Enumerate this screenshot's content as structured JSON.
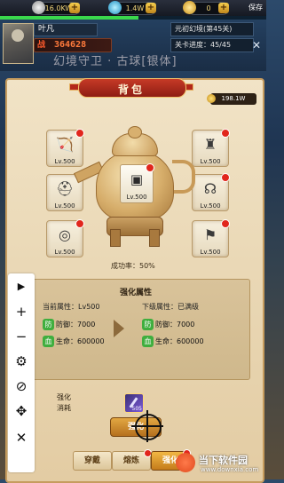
{
  "resources": [
    {
      "value": "16.0KW",
      "icon": "silver-coin-icon",
      "color": "#c9c9c9"
    },
    {
      "value": "1.4W",
      "icon": "diamond-icon",
      "color": "#36c4e8"
    },
    {
      "value": "0",
      "icon": "gold-ingot-icon",
      "color": "#f2c13a"
    }
  ],
  "save_label": "保存",
  "player": {
    "name": "叶凡",
    "power_label": "战",
    "power": "364628",
    "exp_fraction": 0.52
  },
  "stage": {
    "name": "元初幻境(第45关)",
    "progress": "关卡进度：45/45"
  },
  "scene_text": "幻境守卫 · 古球[银体]",
  "bag": {
    "title": "背包",
    "gold": "198.1W",
    "slots_left": [
      {
        "name": "weapon",
        "icon": "bow-icon",
        "glyph": "🏹",
        "level": "Lv.500"
      },
      {
        "name": "helmet",
        "icon": "helmet-icon",
        "glyph": "⛑",
        "level": "Lv.500"
      },
      {
        "name": "bracer",
        "icon": "bracer-icon",
        "glyph": "◎",
        "level": "Lv.500"
      }
    ],
    "slots_right": [
      {
        "name": "armor",
        "icon": "armor-icon",
        "glyph": "♜",
        "level": "Lv.500"
      },
      {
        "name": "necklace",
        "icon": "necklace-icon",
        "glyph": "☊",
        "level": "Lv.500"
      },
      {
        "name": "boots",
        "icon": "boots-icon",
        "glyph": "⚑",
        "level": "Lv.500"
      }
    ],
    "center_slot": {
      "icon": "belt-icon",
      "glyph": "▣",
      "level": "Lv.500"
    },
    "success_rate": "成功率：50%"
  },
  "enhance": {
    "title": "强化属性",
    "current": {
      "header": "当前属性：Lv500",
      "rows": [
        {
          "tag": "防",
          "label": "防御：",
          "value": "7000"
        },
        {
          "tag": "血",
          "label": "生命：",
          "value": "600000"
        }
      ]
    },
    "next": {
      "header": "下级属性：已满级",
      "rows": [
        {
          "tag": "防",
          "label": "防御：",
          "value": "7000"
        },
        {
          "tag": "血",
          "label": "生命：",
          "value": "600000"
        }
      ]
    },
    "cost_label_1": "强化",
    "cost_label_2": "消耗",
    "material_count": "505",
    "button": "强化"
  },
  "tabs": [
    {
      "label": "穿戴",
      "active": false
    },
    {
      "label": "熔炼",
      "active": false
    },
    {
      "label": "强化",
      "active": true
    }
  ],
  "toolbar": [
    {
      "icon": "play-icon",
      "glyph": "▶"
    },
    {
      "icon": "zoom-in-icon",
      "glyph": "+"
    },
    {
      "icon": "zoom-out-icon",
      "glyph": "−"
    },
    {
      "icon": "settings-icon",
      "glyph": "⚙"
    },
    {
      "icon": "hide-icon",
      "glyph": "⊘"
    },
    {
      "icon": "move-icon",
      "glyph": "✥"
    },
    {
      "icon": "close-icon",
      "glyph": "✕"
    }
  ],
  "watermark": {
    "title": "当下软件园",
    "url": "www.downxia.com"
  }
}
